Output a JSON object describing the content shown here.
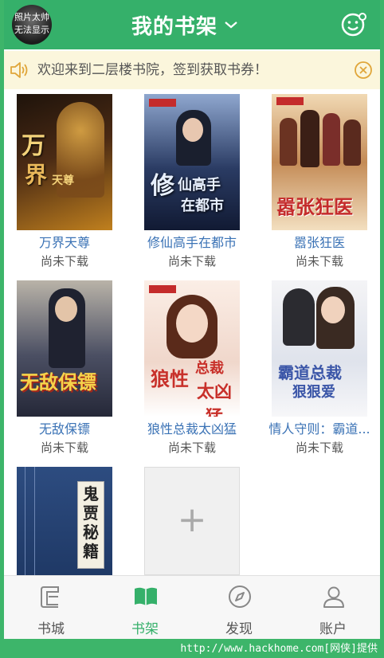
{
  "header": {
    "avatar_text_line1": "照片太帅",
    "avatar_text_line2": "无法显示",
    "title": "我的书架",
    "accent": "#35b06a"
  },
  "notice": {
    "text": "欢迎来到二层楼书院，签到获取书券！",
    "background": "#fbf6dc"
  },
  "books": [
    {
      "title": "万界天尊",
      "status": "尚未下载",
      "cover_text": "万界天尊",
      "cover_colors": [
        "#2a1a10",
        "#b8741e"
      ]
    },
    {
      "title": "修仙高手在都市",
      "status": "尚未下载",
      "cover_text": "修仙高手在都市",
      "cover_colors": [
        "#1c2b4a",
        "#6e86b6"
      ]
    },
    {
      "title": "嚣张狂医",
      "status": "尚未下载",
      "cover_text": "嚣张狂医",
      "cover_colors": [
        "#7a4a2a",
        "#e5c59a"
      ]
    },
    {
      "title": "无敌保镖",
      "status": "尚未下载",
      "cover_text": "无敌保镖",
      "cover_colors": [
        "#3a3f5c",
        "#c9a64a"
      ]
    },
    {
      "title": "狼性总裁太凶猛",
      "status": "尚未下载",
      "cover_text": "狼性总裁太凶猛",
      "cover_colors": [
        "#f2e3da",
        "#c84a3a"
      ]
    },
    {
      "title": "情人守则：霸道...",
      "status": "尚未下载",
      "cover_text": "霸道总裁狠狠爱",
      "cover_colors": [
        "#e7eaf2",
        "#4a62a8"
      ]
    },
    {
      "title": "",
      "status": "",
      "cover_text": "鬼贾秘籍",
      "cover_colors": [
        "#2c4a7a",
        "#1d3560"
      ]
    }
  ],
  "add_tile": {
    "symbol": "+"
  },
  "tabs": [
    {
      "label": "书城",
      "icon": "bookstore-icon"
    },
    {
      "label": "书架",
      "icon": "bookshelf-icon",
      "active": true
    },
    {
      "label": "发现",
      "icon": "compass-icon"
    },
    {
      "label": "账户",
      "icon": "account-icon"
    }
  ],
  "watermark": "http://www.hackhome.com[网侠]提供"
}
